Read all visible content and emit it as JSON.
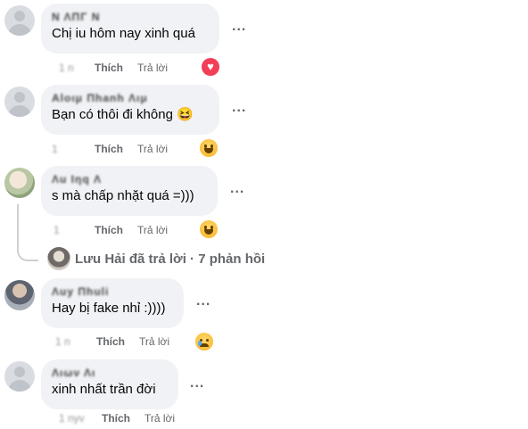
{
  "comments": [
    {
      "author": "Ν ΛΠΓ Ν",
      "text": "Chị iu hôm nay xinh quá",
      "time": "1 n",
      "like_label": "Thích",
      "reply_label": "Trả lời",
      "reaction": "heart"
    },
    {
      "author": "Αlοιμ Πhanh Λιμ",
      "text": "Bạn có thôi đi không 😆",
      "time": "1",
      "like_label": "Thích",
      "reply_label": "Trả lời",
      "reaction": "haha"
    },
    {
      "author": "Λu Ιηq Λ",
      "text": "s mà chấp nhặt quá =)))",
      "time": "1",
      "like_label": "Thích",
      "reply_label": "Trả lời",
      "reaction": "haha"
    },
    {
      "author": "Λuy Πhuli",
      "text": "Hay bị fake nhỉ :))))",
      "time": "1 n",
      "like_label": "Thích",
      "reply_label": "Trả lời",
      "reaction": "sad"
    },
    {
      "author": "Λιων Λι",
      "text": "xinh nhất trần đời",
      "time": "1 nyv",
      "like_label": "Thích",
      "reply_label": "Trả lời",
      "reaction": ""
    }
  ],
  "reply_summary": "Lưu Hải đã trả lời · 7 phản hồi",
  "more_label": "..."
}
